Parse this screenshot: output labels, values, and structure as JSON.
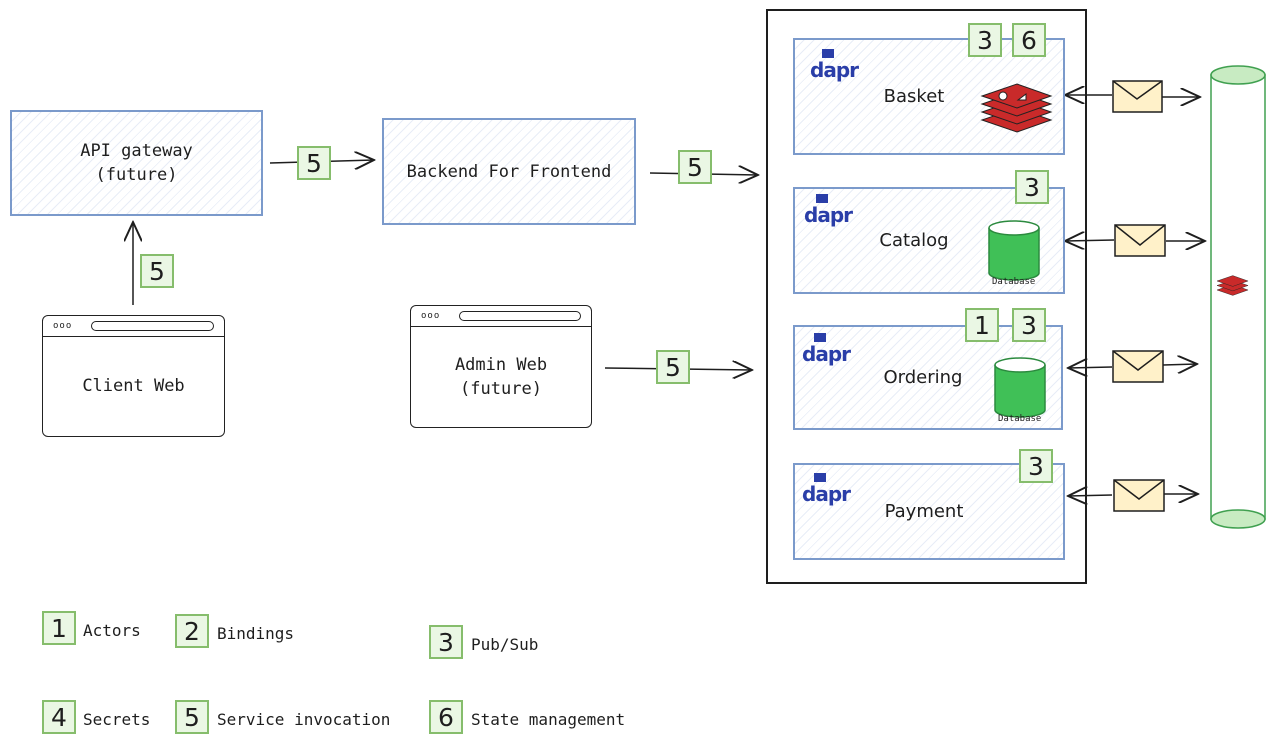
{
  "nodes": {
    "api_gateway": [
      "API gateway",
      "(future)"
    ],
    "bff": "Backend For Frontend",
    "client_web": "Client Web",
    "admin_web": [
      "Admin Web",
      "(future)"
    ],
    "browser_dots": "ooo"
  },
  "services": [
    {
      "name": "Basket",
      "badges": [
        "3",
        "6"
      ],
      "store": "redis"
    },
    {
      "name": "Catalog",
      "badges": [
        "3"
      ],
      "store": "database",
      "store_label": "Database"
    },
    {
      "name": "Ordering",
      "badges": [
        "1",
        "3"
      ],
      "store": "database",
      "store_label": "Database"
    },
    {
      "name": "Payment",
      "badges": [
        "3"
      ]
    }
  ],
  "dapr_logo": "dapr",
  "edge_badges": {
    "gateway_to_bff": "5",
    "bff_to_services": "5",
    "client_to_gateway": "5",
    "admin_to_services": "5"
  },
  "legend": [
    {
      "num": "1",
      "label": "Actors"
    },
    {
      "num": "2",
      "label": "Bindings"
    },
    {
      "num": "3",
      "label": "Pub/Sub"
    },
    {
      "num": "4",
      "label": "Secrets"
    },
    {
      "num": "5",
      "label": "Service invocation"
    },
    {
      "num": "6",
      "label": "State management"
    }
  ],
  "colors": {
    "service_border": "#7b9acb",
    "badge_border": "#86bd6c",
    "badge_fill": "#eaf7e4",
    "database": "#40c057",
    "redis": "#c92a2a",
    "envelope": "#fff1c9",
    "bus": "#40a050",
    "dapr": "#2a3ea8"
  }
}
